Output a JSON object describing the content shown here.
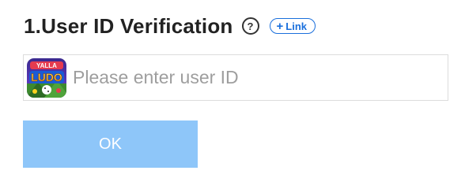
{
  "header": {
    "title": "1.User ID Verification",
    "help_icon": "question-circle-icon",
    "help_glyph": "?",
    "link_chip": {
      "icon": "plus-icon",
      "plus_glyph": "+",
      "label": "Link"
    }
  },
  "user_id_field": {
    "placeholder": "Please enter user ID",
    "value": "",
    "app_logo": "yalla-ludo-logo"
  },
  "ok_button": {
    "label": "OK"
  },
  "colors": {
    "title_text": "#222222",
    "link_accent": "#1a6fdc",
    "button_background": "#8ec6f9",
    "button_text": "#ffffff",
    "input_border": "#dcdcdc",
    "placeholder_text": "#9e9e9e"
  }
}
